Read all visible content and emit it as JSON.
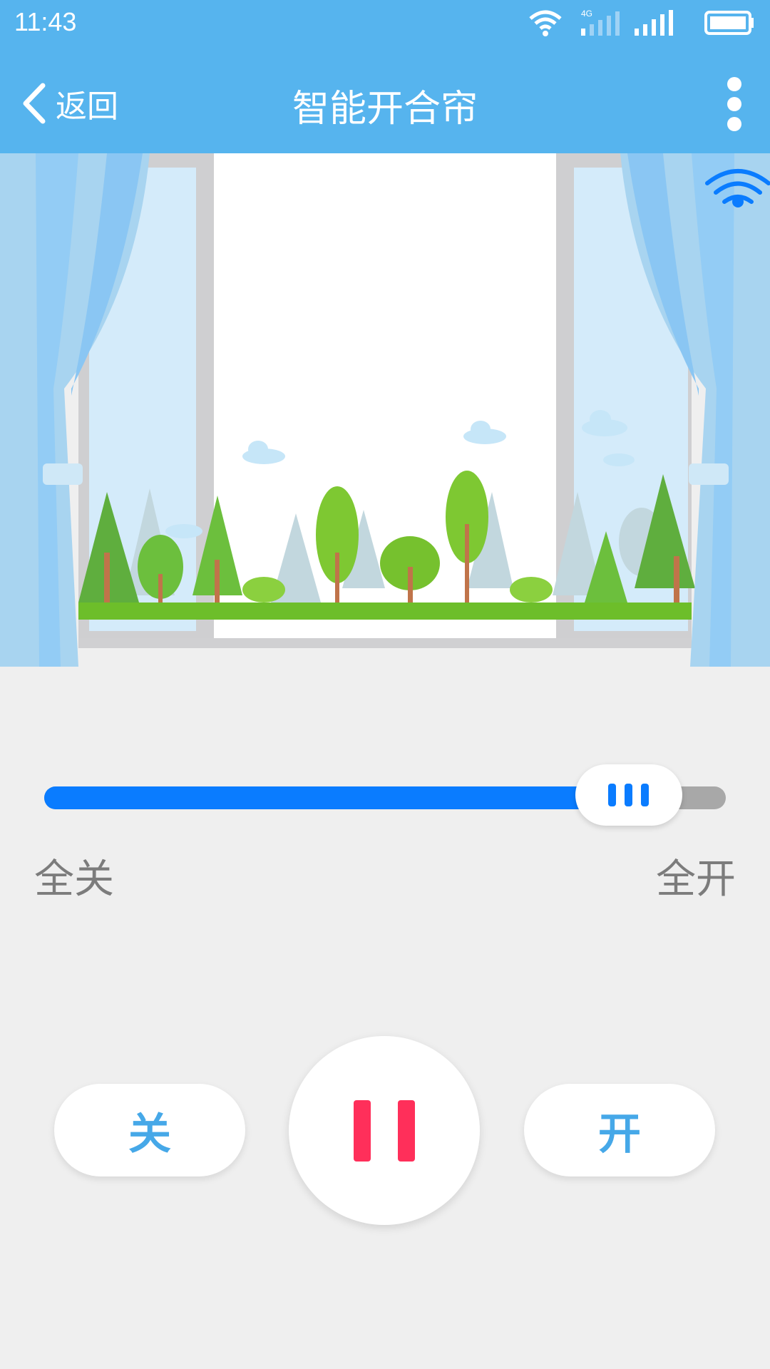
{
  "status": {
    "time": "11:43",
    "network": "4G"
  },
  "header": {
    "back_label": "返回",
    "title": "智能开合帘"
  },
  "slider": {
    "value_fraction": 0.8,
    "min_label": "全关",
    "max_label": "全开"
  },
  "controls": {
    "close_label": "关",
    "open_label": "开"
  },
  "colors": {
    "accent": "#56b4ee",
    "slider_fill": "#0a7cff",
    "pause": "#ff2f5a"
  }
}
